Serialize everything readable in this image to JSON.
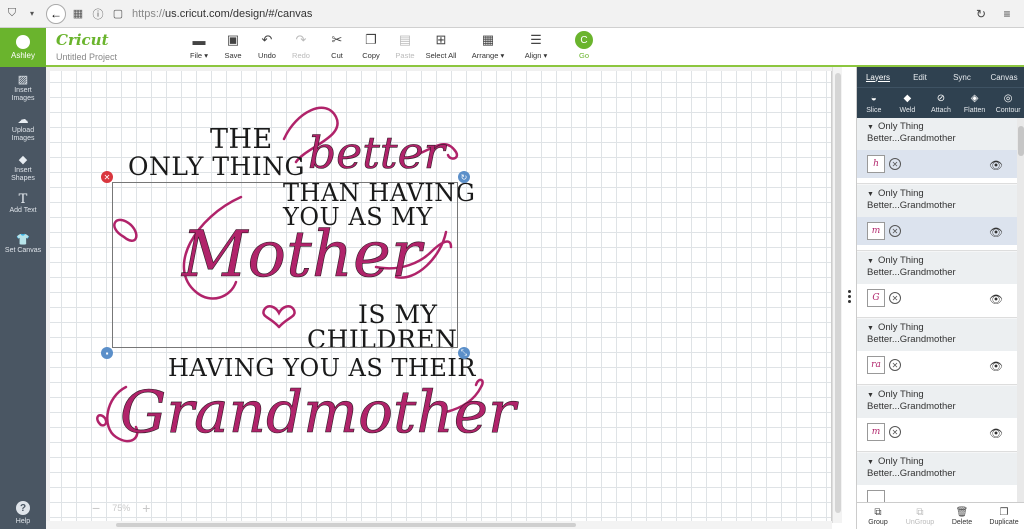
{
  "browser": {
    "url_prefix": "https://",
    "url": "us.cricut.com/design/#/canvas"
  },
  "app": {
    "user_name": "Ashley",
    "logo": "Cricut",
    "project_name": "Untitled Project"
  },
  "toolbar": [
    {
      "label": "File",
      "icon": "folder-icon",
      "dropdown": true,
      "enabled": true
    },
    {
      "label": "Save",
      "icon": "save-icon",
      "dropdown": false,
      "enabled": true
    },
    {
      "label": "Undo",
      "icon": "undo-icon",
      "dropdown": false,
      "enabled": true
    },
    {
      "label": "Redo",
      "icon": "redo-icon",
      "dropdown": false,
      "enabled": false
    },
    {
      "label": "Cut",
      "icon": "cut-icon",
      "dropdown": false,
      "enabled": true
    },
    {
      "label": "Copy",
      "icon": "copy-icon",
      "dropdown": false,
      "enabled": true
    },
    {
      "label": "Paste",
      "icon": "paste-icon",
      "dropdown": false,
      "enabled": false
    },
    {
      "label": "Select All",
      "icon": "select-all-icon",
      "dropdown": false,
      "enabled": true
    },
    {
      "label": "Arrange",
      "icon": "arrange-icon",
      "dropdown": true,
      "enabled": true
    },
    {
      "label": "Align",
      "icon": "align-icon",
      "dropdown": true,
      "enabled": true
    },
    {
      "label": "Go",
      "icon": "go-icon",
      "dropdown": false,
      "enabled": true
    }
  ],
  "sidebar": {
    "items": [
      {
        "label_1": "Insert",
        "label_2": "Images",
        "icon": "image-icon"
      },
      {
        "label_1": "Upload",
        "label_2": "Images",
        "icon": "upload-icon"
      },
      {
        "label_1": "Insert",
        "label_2": "Shapes",
        "icon": "shapes-icon"
      },
      {
        "label_1": "Add Text",
        "label_2": "",
        "icon": "text-icon"
      },
      {
        "label_1": "Set Canvas",
        "label_2": "",
        "icon": "tshirt-icon"
      }
    ],
    "help_label": "Help"
  },
  "canvas": {
    "zoom": "75%",
    "design": {
      "line1": "THE",
      "line2": "ONLY THING",
      "script_better": "better",
      "line3": "THAN HAVING",
      "line4": "YOU AS MY",
      "script_mother": "Mother",
      "line5": "IS MY",
      "line6": "CHILDREN",
      "line7": "HAVING YOU AS THEIR",
      "script_grandmother": "Grandmother"
    },
    "accent_color": "#b0236a"
  },
  "right_panel": {
    "tabs": [
      "Layers",
      "Edit",
      "Sync",
      "Canvas"
    ],
    "active_tab": "Layers",
    "tools": [
      "Slice",
      "Weld",
      "Attach",
      "Flatten",
      "Contour"
    ],
    "layers": [
      {
        "line1": "Only Thing",
        "line2": "Better...Grandmother",
        "thumb": "h",
        "selected": true
      },
      {
        "line1": "Only Thing",
        "line2": "Better...Grandmother",
        "thumb": "m",
        "selected": true
      },
      {
        "line1": "Only Thing",
        "line2": "Better...Grandmother",
        "thumb": "G",
        "selected": false
      },
      {
        "line1": "Only Thing",
        "line2": "Better...Grandmother",
        "thumb": "ra",
        "selected": false
      },
      {
        "line1": "Only Thing",
        "line2": "Better...Grandmother",
        "thumb": "m",
        "selected": false
      },
      {
        "line1": "Only Thing",
        "line2": "Better...Grandmother",
        "thumb": "",
        "selected": false
      }
    ],
    "bottom_actions": [
      {
        "label": "Group",
        "enabled": true
      },
      {
        "label": "UnGroup",
        "enabled": false
      },
      {
        "label": "Delete",
        "enabled": true
      },
      {
        "label": "Duplicate",
        "enabled": true
      }
    ]
  }
}
